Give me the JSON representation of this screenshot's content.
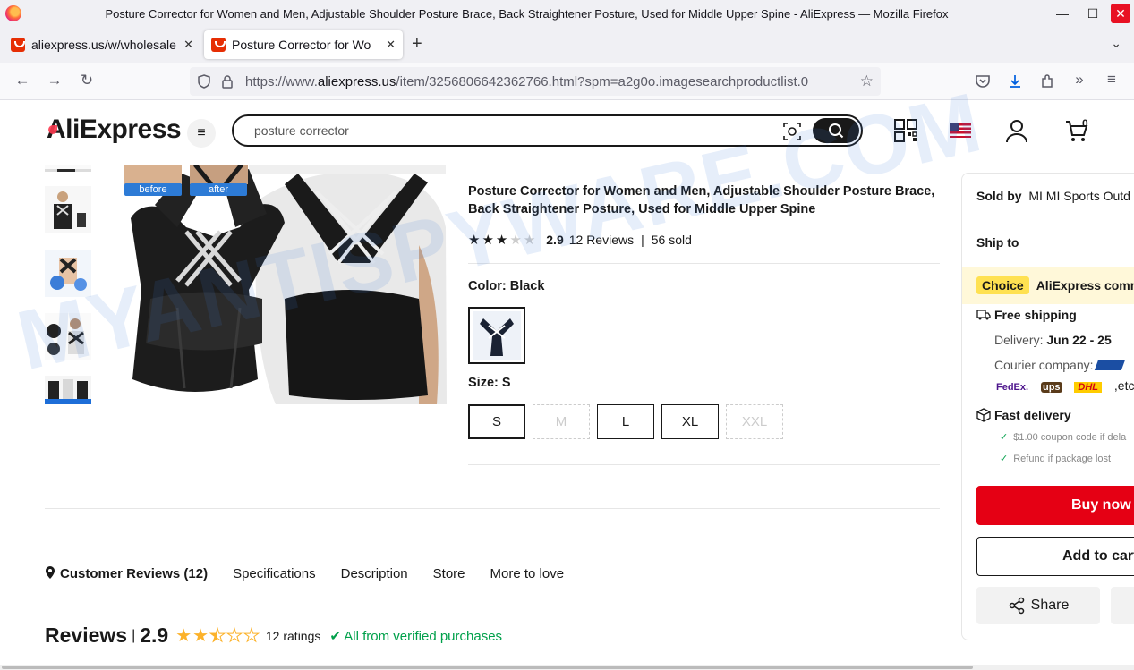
{
  "window": {
    "title": "Posture Corrector for Women and Men, Adjustable Shoulder Posture Brace, Back Straightener Posture, Used for Middle Upper Spine - AliExpress — Mozilla Firefox",
    "minimize": "—",
    "maximize": "☐",
    "close": "✕"
  },
  "tabs": [
    {
      "label": "aliexpress.us/w/wholesale",
      "close": "✕"
    },
    {
      "label": "Posture Corrector for Wo",
      "close": "✕"
    }
  ],
  "toolbar": {
    "new_tab": "+",
    "tab_list": "⌄",
    "back": "←",
    "forward": "→",
    "reload": "↻"
  },
  "url": {
    "prefix": "https://www.",
    "domain": "aliexpress.us",
    "path": "/item/3256806642362766.html?spm=a2g0o.imagesearchproductlist.0"
  },
  "site": {
    "logo_a": "A",
    "logo_rest": "liExpress",
    "search_value": "posture corrector",
    "cart_count": "0"
  },
  "gallery": {
    "before": "before",
    "after": "after"
  },
  "product": {
    "title": "Posture Corrector for Women and Men, Adjustable Shoulder Posture Brace, Back Straightener Posture, Used for Middle Upper Spine",
    "rating": 2.9,
    "rating_text": "2.9",
    "reviews": "12 Reviews",
    "sold": "56 sold",
    "color_label": "Color: ",
    "color_value": "Black",
    "size_label": "Size: ",
    "size_value": "S",
    "sizes": [
      {
        "label": "S",
        "state": "selected"
      },
      {
        "label": "M",
        "state": "disabled"
      },
      {
        "label": "L",
        "state": "available"
      },
      {
        "label": "XL",
        "state": "available"
      },
      {
        "label": "XXL",
        "state": "disabled"
      }
    ]
  },
  "tabs_nav": {
    "reviews": "Customer Reviews (12)",
    "specs": "Specifications",
    "description": "Description",
    "store": "Store",
    "more": "More to love"
  },
  "reviews": {
    "title": "Reviews",
    "score": "2.9",
    "ratings": "12 ratings",
    "verified": "All from verified purchases"
  },
  "panel": {
    "sold_by_label": "Sold by",
    "sold_by_value": "MI MI Sports Outd",
    "ship_to": "Ship to",
    "choice_tag": "Choice",
    "choice_text": "AliExpress comm",
    "free_shipping": "Free shipping",
    "delivery_label": "Delivery: ",
    "delivery_value": "Jun 22 - 25",
    "courier_label": "Courier company:",
    "carriers": [
      "FedEx.",
      "ups",
      "DHL",
      ",etc."
    ],
    "fast_delivery": "Fast delivery",
    "coupon": "$1.00 coupon code if dela",
    "refund": "Refund if package lost",
    "buy_now": "Buy now",
    "add_to_cart": "Add to cart",
    "share": "Share"
  },
  "watermark": "MYANTISPYWARE.COM",
  "colors": {
    "brand_red": "#e50014",
    "choice_yellow": "#ffe151",
    "verified_green": "#00a04a",
    "star_gold": "#fcb22a"
  }
}
